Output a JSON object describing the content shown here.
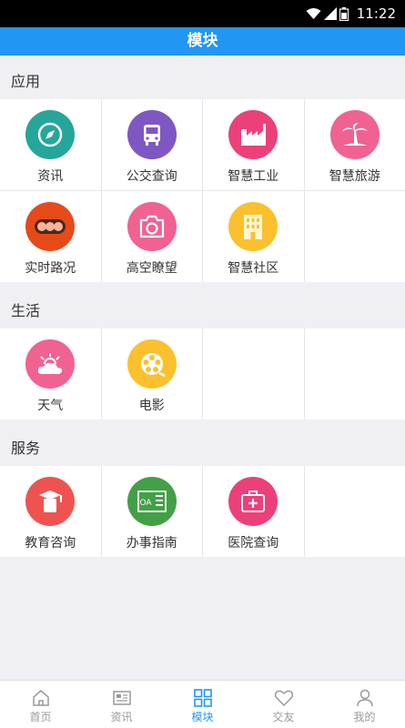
{
  "status": {
    "time": "11:22"
  },
  "header": {
    "title": "模块"
  },
  "sections": [
    {
      "title": "应用",
      "items": [
        {
          "label": "资讯",
          "icon": "compass-icon",
          "color": "#26a69a"
        },
        {
          "label": "公交查询",
          "icon": "bus-icon",
          "color": "#7e57c2"
        },
        {
          "label": "智慧工业",
          "icon": "factory-icon",
          "color": "#ec407a"
        },
        {
          "label": "智慧旅游",
          "icon": "palm-tree-icon",
          "color": "#f06292"
        },
        {
          "label": "实时路况",
          "icon": "traffic-light-icon",
          "color": "#e64a19"
        },
        {
          "label": "高空瞭望",
          "icon": "camera-icon",
          "color": "#f06292"
        },
        {
          "label": "智慧社区",
          "icon": "building-icon",
          "color": "#fbc02d"
        }
      ]
    },
    {
      "title": "生活",
      "items": [
        {
          "label": "天气",
          "icon": "weather-icon",
          "color": "#f06292"
        },
        {
          "label": "电影",
          "icon": "film-reel-icon",
          "color": "#fbc02d"
        }
      ]
    },
    {
      "title": "服务",
      "items": [
        {
          "label": "教育咨询",
          "icon": "graduation-cap-icon",
          "color": "#ef5350"
        },
        {
          "label": "办事指南",
          "icon": "oa-document-icon",
          "color": "#43a047",
          "icon_text": "OA"
        },
        {
          "label": "医院查询",
          "icon": "medical-kit-icon",
          "color": "#ec407a"
        }
      ]
    }
  ],
  "tabs": [
    {
      "label": "首页",
      "icon": "home-icon"
    },
    {
      "label": "资讯",
      "icon": "news-icon"
    },
    {
      "label": "模块",
      "icon": "grid-icon",
      "active": true
    },
    {
      "label": "交友",
      "icon": "heart-icon"
    },
    {
      "label": "我的",
      "icon": "user-icon"
    }
  ],
  "colors": {
    "accent": "#2196f3"
  }
}
